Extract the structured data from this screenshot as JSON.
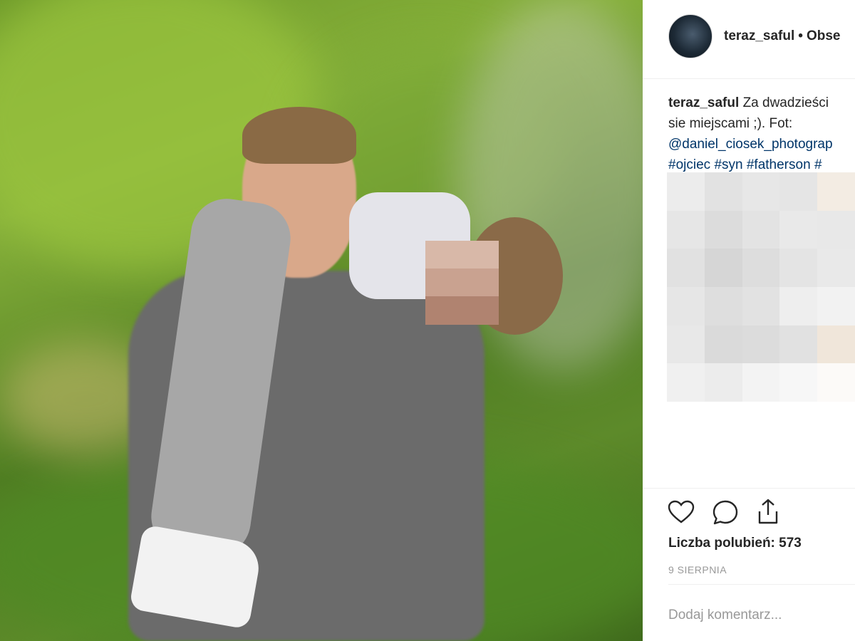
{
  "post": {
    "username": "teraz_saful",
    "separator": "•",
    "follow_label": "Obse",
    "caption": {
      "user": "teraz_saful",
      "text_line1": "Za dwadzieści",
      "text_line2": "sie miejscami ;). Fot:",
      "mention": "@daniel_ciosek_photograp",
      "hashtags": [
        "#ojciec",
        "#syn",
        "#fatherson",
        "#"
      ]
    },
    "likes_text": "Liczba polubień: 573",
    "date": "9 SIERPNIA",
    "comment_placeholder": "Dodaj komentarz..."
  },
  "icons": [
    "heart-icon",
    "comment-icon",
    "share-icon"
  ],
  "colors": {
    "link": "#003569",
    "text": "#262626",
    "muted": "#999999"
  }
}
